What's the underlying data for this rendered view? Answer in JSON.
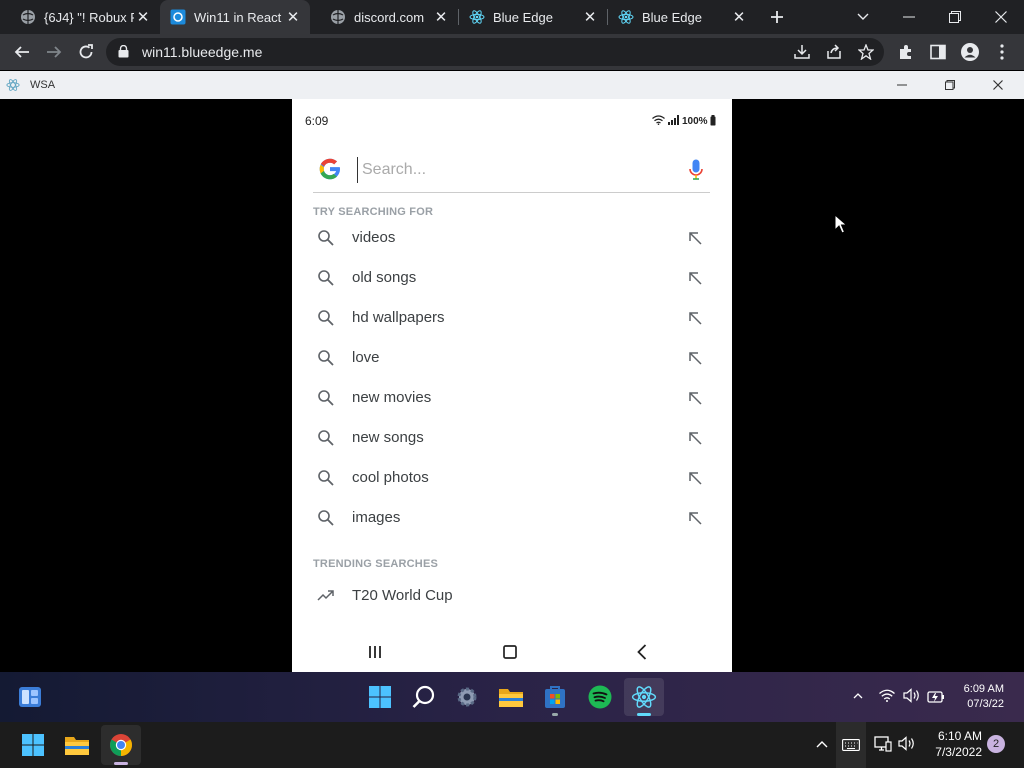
{
  "browser": {
    "tabs": [
      {
        "title": "{6J4} \"! Robux Fr",
        "active": false
      },
      {
        "title": "Win11 in React",
        "active": true
      },
      {
        "title": "discord.com",
        "active": false
      },
      {
        "title": "Blue Edge",
        "active": false
      },
      {
        "title": "Blue Edge",
        "active": false
      }
    ],
    "url": "win11.blueedge.me"
  },
  "wsa": {
    "title": "WSA"
  },
  "phone": {
    "status_time": "6:09",
    "battery": "100%",
    "search_placeholder": "Search...",
    "try_heading": "TRY SEARCHING FOR",
    "suggestions": [
      "videos",
      "old songs",
      "hd wallpapers",
      "love",
      "new movies",
      "new songs",
      "cool photos",
      "images"
    ],
    "trending_heading": "TRENDING SEARCHES",
    "trending": [
      "T20 World Cup"
    ]
  },
  "inner_taskbar": {
    "time": "6:09 AM",
    "date": "07/3/22"
  },
  "host_taskbar": {
    "time": "6:10 AM",
    "date": "7/3/2022",
    "notifications": "2"
  },
  "colors": {
    "google_blue": "#4285F4",
    "google_red": "#EA4335",
    "google_yellow": "#FBBC05",
    "google_green": "#34A853",
    "spotify": "#1DB954",
    "react": "#61DAFB"
  }
}
